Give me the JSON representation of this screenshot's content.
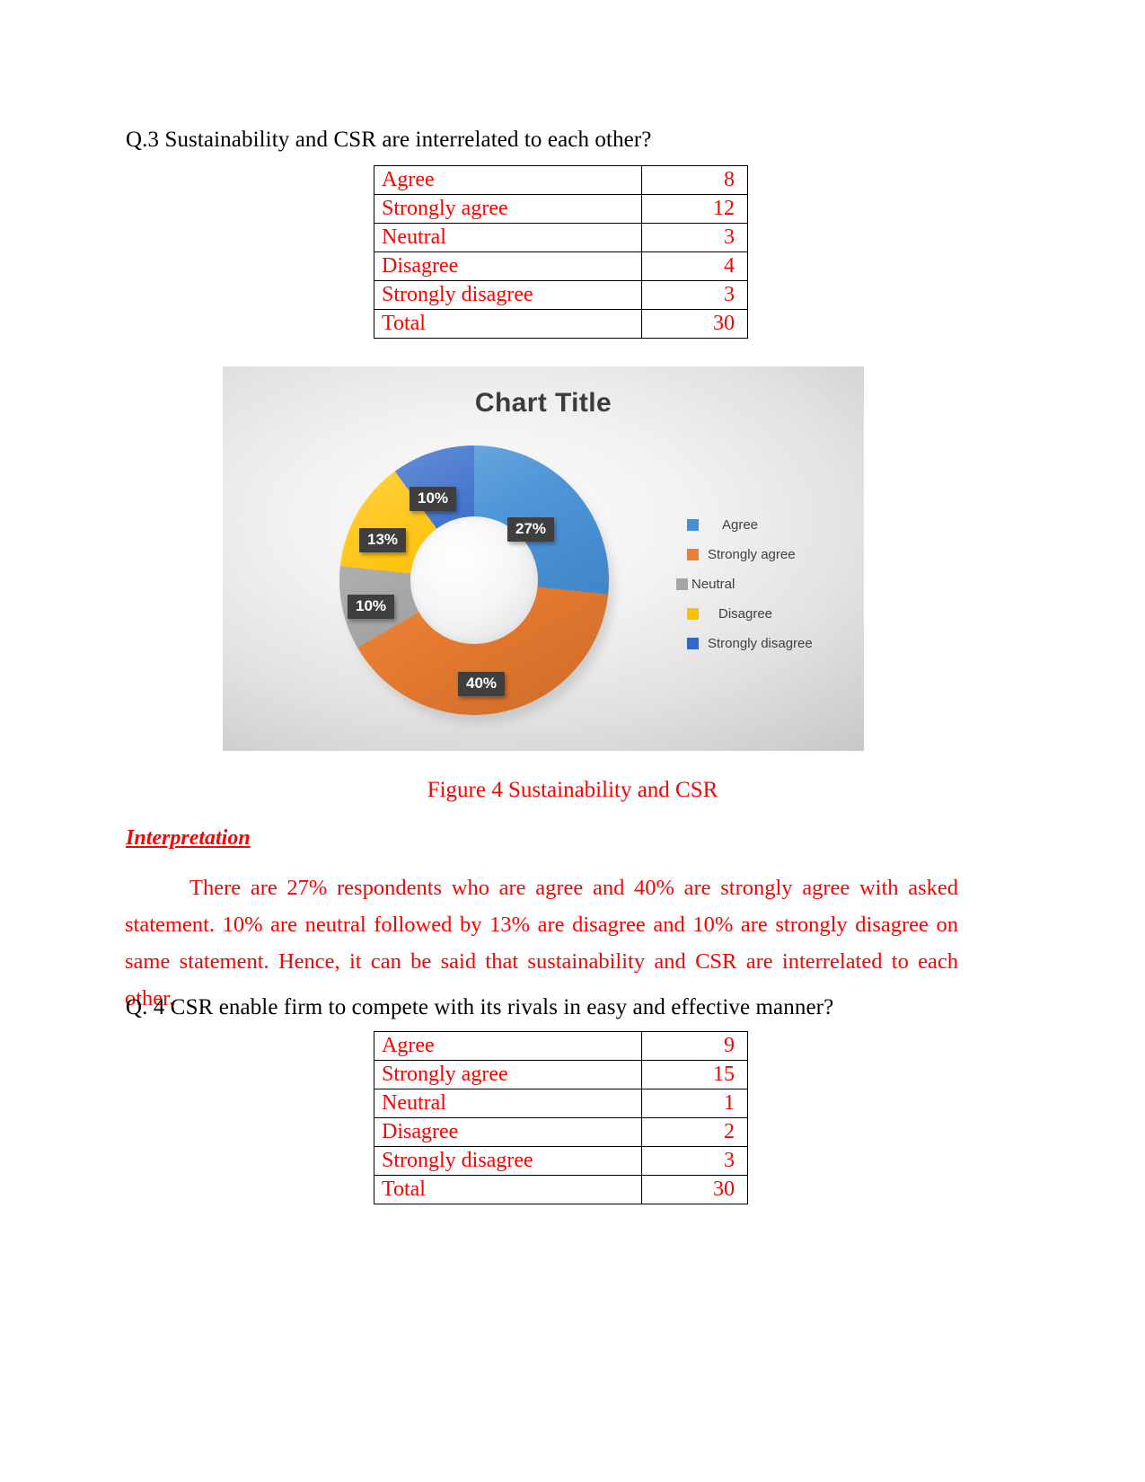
{
  "document": {
    "question3": "Q.3 Sustainability and CSR are interrelated to each other?",
    "question4": "Q. 4 CSR enable firm to compete with its rivals in easy and effective manner?",
    "figure_caption": "Figure 4 Sustainability and CSR",
    "interpretation_heading": "Interpretation ",
    "interpretation_body": "There are 27% respondents who are agree and 40% are strongly agree with asked statement. 10% are neutral followed by 13% are disagree and 10% are strongly disagree on same statement. Hence, it can be said that sustainability and CSR are interrelated to each other.",
    "text_color_black": "#000000",
    "text_color_red": "#ff0000"
  },
  "table_q3": {
    "rows": [
      {
        "label": "Agree",
        "value": "8"
      },
      {
        "label": "Strongly agree",
        "value": "12"
      },
      {
        "label": "Neutral",
        "value": "3"
      },
      {
        "label": "Disagree",
        "value": "4"
      },
      {
        "label": "Strongly disagree",
        "value": "3"
      },
      {
        "label": "Total",
        "value": "30"
      }
    ]
  },
  "table_q4": {
    "rows": [
      {
        "label": "Agree",
        "value": "9"
      },
      {
        "label": "Strongly agree",
        "value": "15"
      },
      {
        "label": "Neutral",
        "value": "1"
      },
      {
        "label": "Disagree",
        "value": "2"
      },
      {
        "label": "Strongly disagree",
        "value": "3"
      },
      {
        "label": "Total",
        "value": "30"
      }
    ]
  },
  "chart_data": {
    "type": "pie",
    "variant": "doughnut",
    "title": "Chart Title",
    "categories": [
      "Agree",
      "Strongly agree",
      "Neutral",
      "Disagree",
      "Strongly disagree"
    ],
    "values": [
      8,
      12,
      3,
      4,
      3
    ],
    "percent_labels": [
      "27%",
      "40%",
      "10%",
      "13%",
      "10%"
    ],
    "colors": [
      "#4590d5",
      "#ed7d31",
      "#a5a5a5",
      "#ffc000",
      "#3167c8"
    ],
    "legend": {
      "position": "right",
      "entries": [
        "Agree",
        "Strongly agree",
        "Neutral",
        "Disagree",
        "Strongly disagree"
      ]
    },
    "data_label_style": {
      "background": "#3f3f3f",
      "text_color": "#ffffff"
    },
    "total": 30,
    "xlabel": "",
    "ylabel": "",
    "grid": false
  }
}
